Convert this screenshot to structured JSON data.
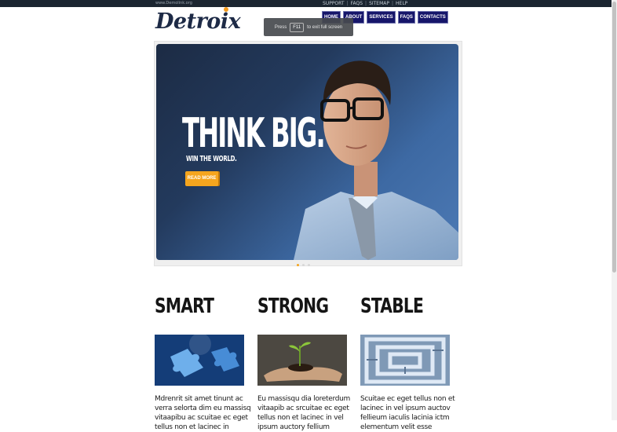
{
  "top_bar": {
    "domain": "www.Demolink.org",
    "links": [
      "SUPPORT",
      "FAQS",
      "SITEMAP",
      "HELP"
    ]
  },
  "logo": {
    "text_before": "Detro",
    "text_o": "i",
    "text_after": "x"
  },
  "nav": [
    "HOME",
    "ABOUT",
    "SERVICES",
    "FAQS",
    "CONTACTS"
  ],
  "fullscreen_toast": {
    "prefix": "Press",
    "key": "F11",
    "suffix": "to exit full screen"
  },
  "hero": {
    "headline": "THINK BIG.",
    "subline": "WIN THE WORLD.",
    "button": "READ MORE",
    "slide_count": 3,
    "active_slide": 1
  },
  "columns": [
    {
      "title": "SMART",
      "image": "puzzle-image",
      "text": "Mdrenrit sit amet tinunt ac verra selorta dim eu massisq vitaapibu ac scuitae ec eget tellus non et lacinec in"
    },
    {
      "title": "STRONG",
      "image": "sprout-in-hands-image",
      "text": "Eu massisqu dia loreterdum vitaapib ac srcuitae ec eget tellus non et lacinec in vel ipsum auctory fellium"
    },
    {
      "title": "STABLE",
      "image": "maze-image",
      "text": "Scuitae ec eget tellus non et lacinec in vel ipsum auctov fellieum iaculis lacinia ictm elementum velit esse"
    }
  ],
  "colors": {
    "nav_bg": "#16166a",
    "accent": "#f5a51e",
    "topbar": "#1b2530"
  }
}
